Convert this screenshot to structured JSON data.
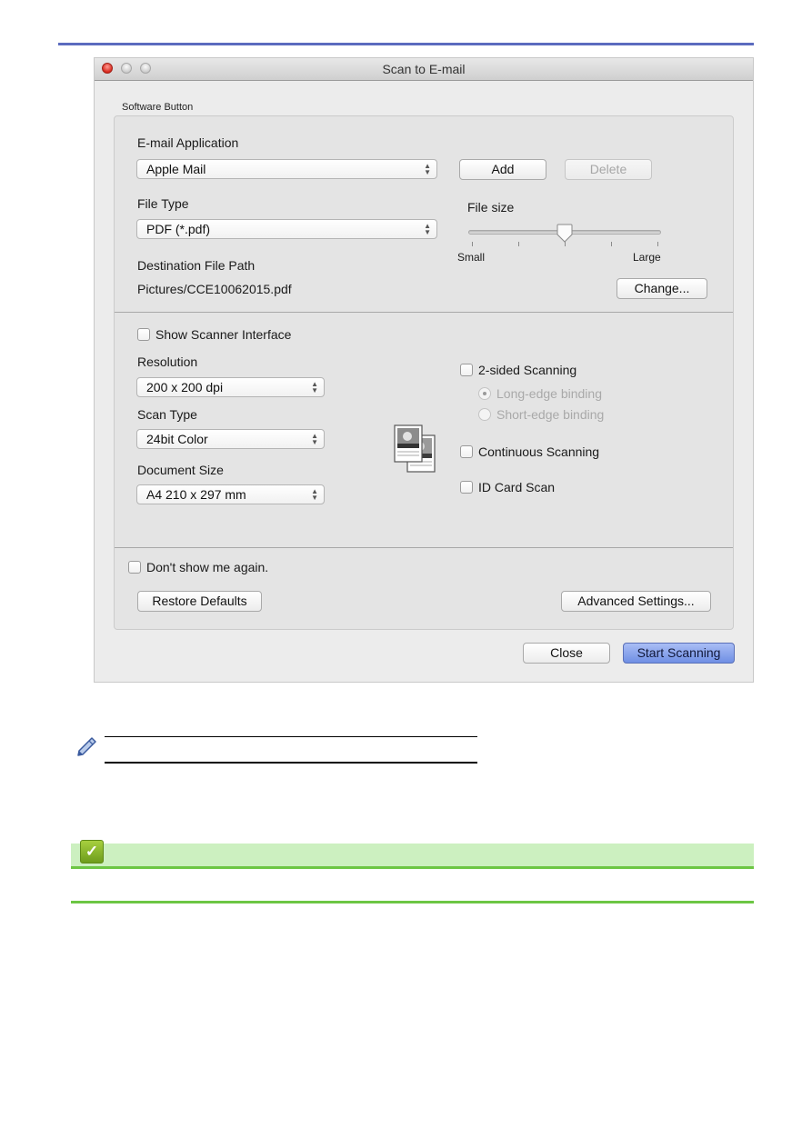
{
  "window": {
    "title": "Scan to E-mail",
    "controls": [
      "close",
      "minimize",
      "zoom"
    ]
  },
  "group": {
    "label": "Software Button"
  },
  "email_application": {
    "label": "E-mail Application",
    "selected": "Apple Mail",
    "add_label": "Add",
    "delete_label": "Delete"
  },
  "file_type": {
    "label": "File Type",
    "selected": "PDF (*.pdf)"
  },
  "file_size": {
    "label": "File size",
    "min_label": "Small",
    "max_label": "Large",
    "tick_count": 5,
    "value_fraction": 0.5
  },
  "destination": {
    "label": "Destination File Path",
    "path": "Pictures/CCE10062015.pdf",
    "change_label": "Change..."
  },
  "scanner": {
    "show_interface_label": "Show Scanner Interface",
    "show_interface_checked": false,
    "resolution_label": "Resolution",
    "resolution_value": "200 x 200 dpi",
    "scan_type_label": "Scan Type",
    "scan_type_value": "24bit Color",
    "document_size_label": "Document Size",
    "document_size_value": "A4 210 x 297 mm"
  },
  "options": {
    "two_sided_label": "2-sided Scanning",
    "two_sided_checked": false,
    "long_edge_label": "Long-edge binding",
    "long_edge_selected": true,
    "short_edge_label": "Short-edge binding",
    "short_edge_selected": false,
    "continuous_label": "Continuous Scanning",
    "continuous_checked": false,
    "id_card_label": "ID Card Scan",
    "id_card_checked": false
  },
  "footer": {
    "dont_show_label": "Don't show me again.",
    "dont_show_checked": false,
    "restore_defaults_label": "Restore Defaults",
    "advanced_settings_label": "Advanced Settings...",
    "close_label": "Close",
    "start_scanning_label": "Start Scanning"
  },
  "colors": {
    "header_rule": "#5b6bbf",
    "related_bar": "#ccf0c0",
    "related_line": "#6cc644",
    "primary_button": "#6f8fe4"
  },
  "icons": {
    "note": "pencil-icon",
    "related": "checkmark-icon",
    "scan_preview": "duplex-document-icon"
  }
}
